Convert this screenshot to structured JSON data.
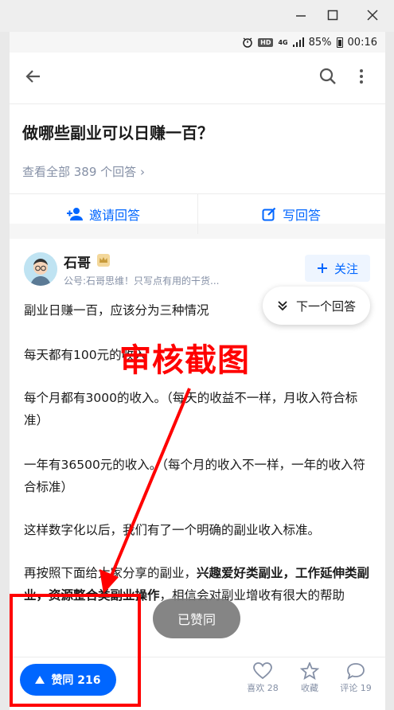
{
  "status_bar": {
    "hd": "HD",
    "network": "4G",
    "battery": "85%",
    "time": "00:16"
  },
  "question": {
    "title": "做哪些副业可以日赚一百？",
    "view_all": "查看全部 389 个回答",
    "invite_label": "邀请回答",
    "write_label": "写回答"
  },
  "answer": {
    "author": "石哥",
    "bio": "公号:石哥思维！只写点有用的干货...",
    "follow_label": "关注",
    "next_label": "下一个回答",
    "paragraphs": [
      "副业日赚一百，应该分为三种情况",
      "每天都有100元的收入",
      "每个月都有3000的收入。（每天的收益不一样，月收入符合标准）",
      "一年有36500元的收入。（每个月的收入不一样，一年的收入符合标准）",
      "这样数字化以后，我们有了一个明确的副业收入标准。"
    ],
    "p6_a": "再按照下面给大家分享的副业，",
    "p6_b": "兴趣爱好类副业，工作延伸类副业，资源整合类副业操作",
    "p6_c": "，相信会对副业增收有很大的帮助"
  },
  "watermark": "审核截图",
  "toast": "已赞同",
  "bottom_bar": {
    "vote_label": "赞同 216",
    "like_label": "喜欢 28",
    "collect_label": "收藏",
    "comment_label": "评论 19"
  },
  "colors": {
    "accent": "#0066ff",
    "annotation": "#ff0000",
    "muted": "#8590a6"
  }
}
